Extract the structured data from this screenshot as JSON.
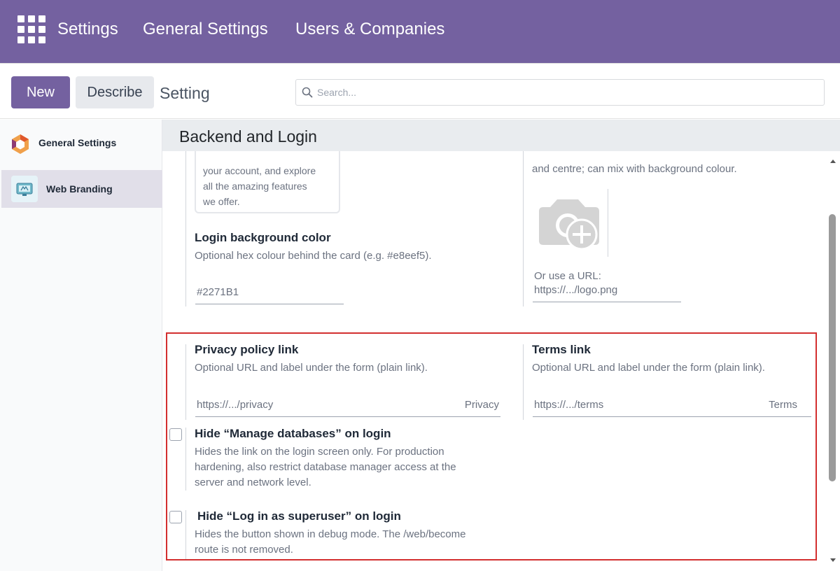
{
  "navbar": {
    "app_name": "Settings",
    "menu": [
      "General Settings",
      "Users & Companies"
    ]
  },
  "control_panel": {
    "new_label": "New",
    "describe_label": "Describe",
    "title": "Setting",
    "search_placeholder": "Search..."
  },
  "sidebar": {
    "items": [
      {
        "label": "General Settings",
        "icon": "odoo-logo-icon",
        "active": false
      },
      {
        "label": "Web Branding",
        "icon": "web-branding-icon",
        "active": true
      }
    ]
  },
  "section": {
    "title": "Backend and Login"
  },
  "login_card_snippet": [
    "your account, and explore",
    "all the amazing features",
    "we offer."
  ],
  "logo_desc_tail": "and centre; can mix with background colour.",
  "login_bg": {
    "title": "Login background color",
    "desc": "Optional hex colour behind the card (e.g. #e8eef5).",
    "value": "#2271B1"
  },
  "logo_url": {
    "label": "Or use a URL:",
    "placeholder": "https://.../logo.png"
  },
  "privacy": {
    "title": "Privacy policy link",
    "desc": "Optional URL and label under the form (plain link).",
    "url_placeholder": "https://.../privacy",
    "label_placeholder": "Privacy"
  },
  "terms": {
    "title": "Terms link",
    "desc": "Optional URL and label under the form (plain link).",
    "url_placeholder": "https://.../terms",
    "label_placeholder": "Terms"
  },
  "hide_db": {
    "title": "Hide “Manage databases” on login",
    "desc_lines": [
      "Hides the link on the login screen only. For production",
      "hardening, also restrict database manager access at the",
      "server and network level."
    ],
    "checked": false
  },
  "hide_superuser": {
    "title": "Hide “Log in as superuser” on login",
    "desc_lines": [
      "Hides the button shown in debug mode. The /web/become",
      "route is not removed."
    ],
    "checked": false
  },
  "colors": {
    "brand": "#7461a0",
    "highlight": "#d32f2f"
  }
}
